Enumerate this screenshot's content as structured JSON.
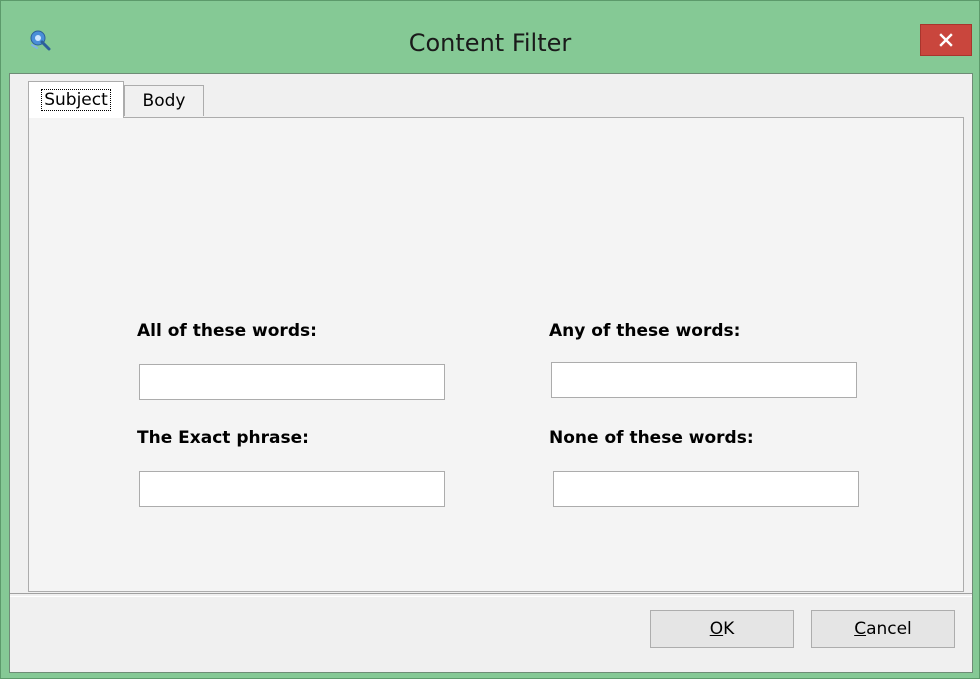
{
  "window": {
    "title": "Content Filter",
    "app_icon": "app-icon",
    "close_icon": "close-icon"
  },
  "tabs": [
    {
      "label": "Subject",
      "selected": true
    },
    {
      "label": "Body",
      "selected": false
    }
  ],
  "fields": {
    "all_words": {
      "label": "All of these words:",
      "value": ""
    },
    "any_words": {
      "label": "Any of these words:",
      "value": ""
    },
    "exact_phrase": {
      "label": "The Exact phrase:",
      "value": ""
    },
    "none_words": {
      "label": "None of these words:",
      "value": ""
    }
  },
  "buttons": {
    "ok_mnemonic": "O",
    "ok_rest": "K",
    "cancel_mnemonic": "C",
    "cancel_rest": "ancel"
  },
  "colors": {
    "titlebar": "#85c995",
    "close_button": "#c9463d"
  }
}
